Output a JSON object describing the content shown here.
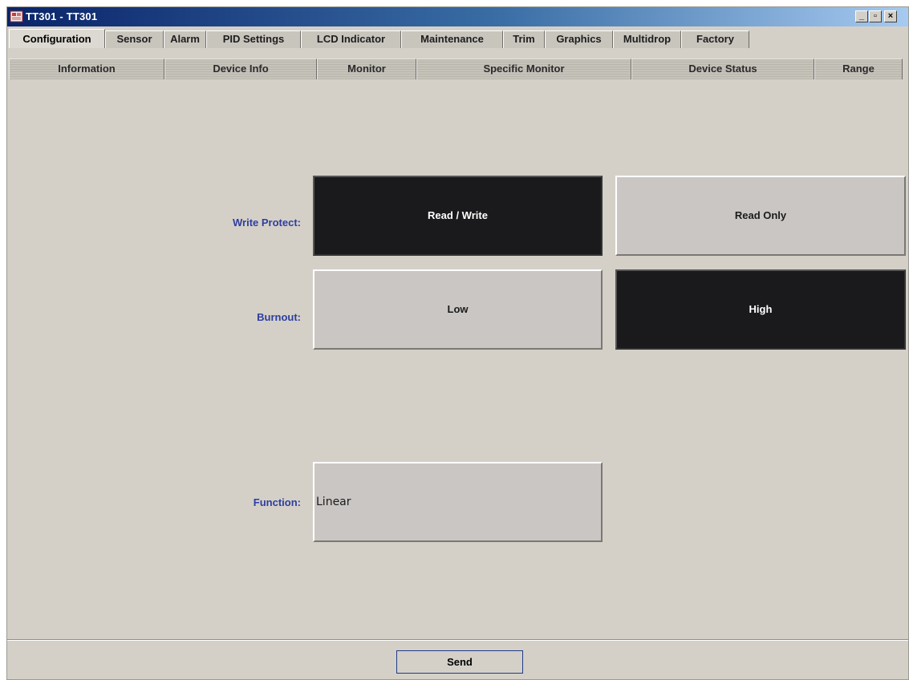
{
  "window": {
    "title": "TT301 - TT301",
    "controls": {
      "minimize": "_",
      "maximize": "▫",
      "close": "×"
    }
  },
  "main_tabs": [
    {
      "label": "Configuration",
      "active": true
    },
    {
      "label": "Sensor",
      "active": false
    },
    {
      "label": "Alarm",
      "active": false
    },
    {
      "label": "PID Settings",
      "active": false
    },
    {
      "label": "LCD Indicator",
      "active": false
    },
    {
      "label": "Maintenance",
      "active": false
    },
    {
      "label": "Trim",
      "active": false
    },
    {
      "label": "Graphics",
      "active": false
    },
    {
      "label": "Multidrop",
      "active": false
    },
    {
      "label": "Factory",
      "active": false
    }
  ],
  "sub_tabs": [
    {
      "label": "Information",
      "active": false
    },
    {
      "label": "Device Info",
      "active": false
    },
    {
      "label": "Monitor",
      "active": false
    },
    {
      "label": "Specific Monitor",
      "active": false
    },
    {
      "label": "Device Status",
      "active": false
    },
    {
      "label": "Range",
      "active": false
    }
  ],
  "form": {
    "write_protect": {
      "label": "Write Protect:",
      "options": [
        {
          "label": "Read / Write",
          "selected": true
        },
        {
          "label": "Read Only",
          "selected": false
        }
      ]
    },
    "burnout": {
      "label": "Burnout:",
      "options": [
        {
          "label": "Low",
          "selected": false
        },
        {
          "label": "High",
          "selected": true
        }
      ]
    },
    "function": {
      "label": "Function:",
      "value": "Linear"
    }
  },
  "actions": {
    "send_label": "Send"
  },
  "colors": {
    "label_blue": "#2d3e9f",
    "selected_bg": "#1a1a1c",
    "unselected_bg": "#c9c6c4",
    "panel_bg": "#d4d0c8",
    "titlebar_start": "#0a246a"
  },
  "icons": {
    "app": "app-icon"
  }
}
